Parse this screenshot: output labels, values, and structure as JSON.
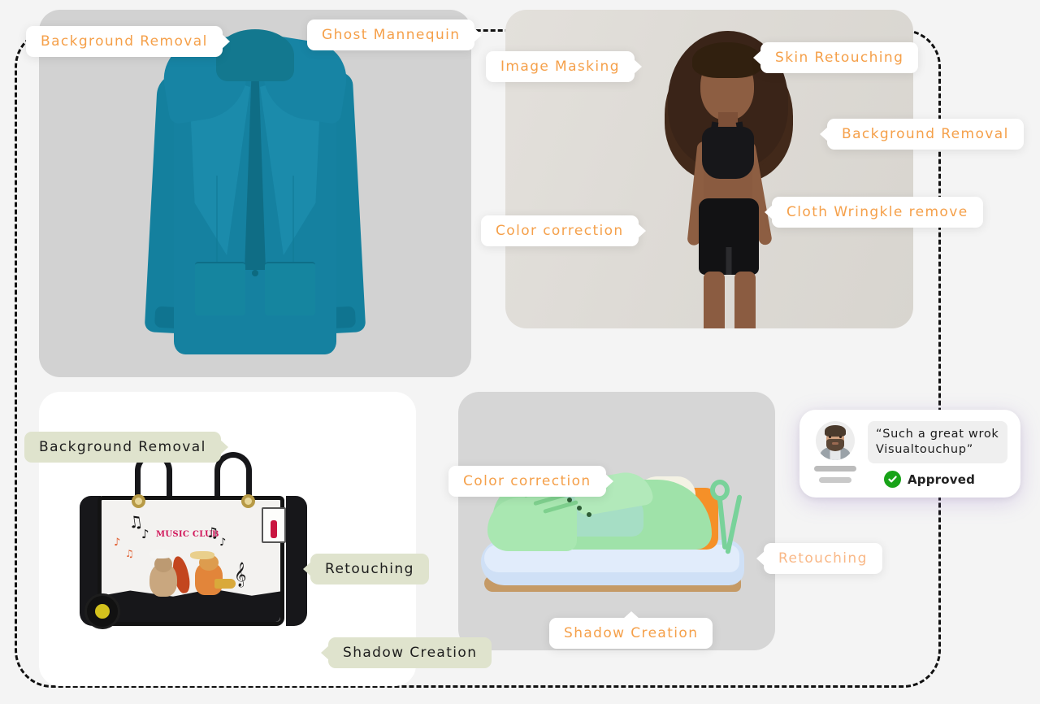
{
  "labels": {
    "background_removal_1": "Background Removal",
    "ghost_mannequin": "Ghost Mannequin",
    "image_masking": "Image Masking",
    "skin_retouching": "Skin Retouching",
    "background_removal_2": "Background Removal",
    "cloth_wrinkle_remove": "Cloth Wringkle remove",
    "color_correction_1": "Color correction",
    "background_removal_3": "Background Removal",
    "retouching_1": "Retouching",
    "shadow_creation_1": "Shadow Creation",
    "color_correction_2": "Color correction",
    "retouching_2": "Retouching",
    "shadow_creation_2": "Shadow Creation"
  },
  "testimonial": {
    "quote": "“Such a great wrok Visualtouchup”",
    "status": "Approved",
    "status_icon": "check-circle-icon"
  },
  "panels": {
    "blazer": "teal-blazer-product-photo",
    "model": "fitness-model-photo",
    "bag": "music-club-handbag-product-photo",
    "shoe": "green-chunky-sneaker-product-photo"
  },
  "colors": {
    "accent_orange": "#f5a04a",
    "accent_orange_soft": "#f9b887",
    "chip_green": "#dfe3cd",
    "approved_green": "#18a318",
    "page_background": "#f4f4f4",
    "blazer_teal": "#1581a0",
    "sneaker_green": "#9fe2a9",
    "sneaker_orange": "#f59028"
  }
}
